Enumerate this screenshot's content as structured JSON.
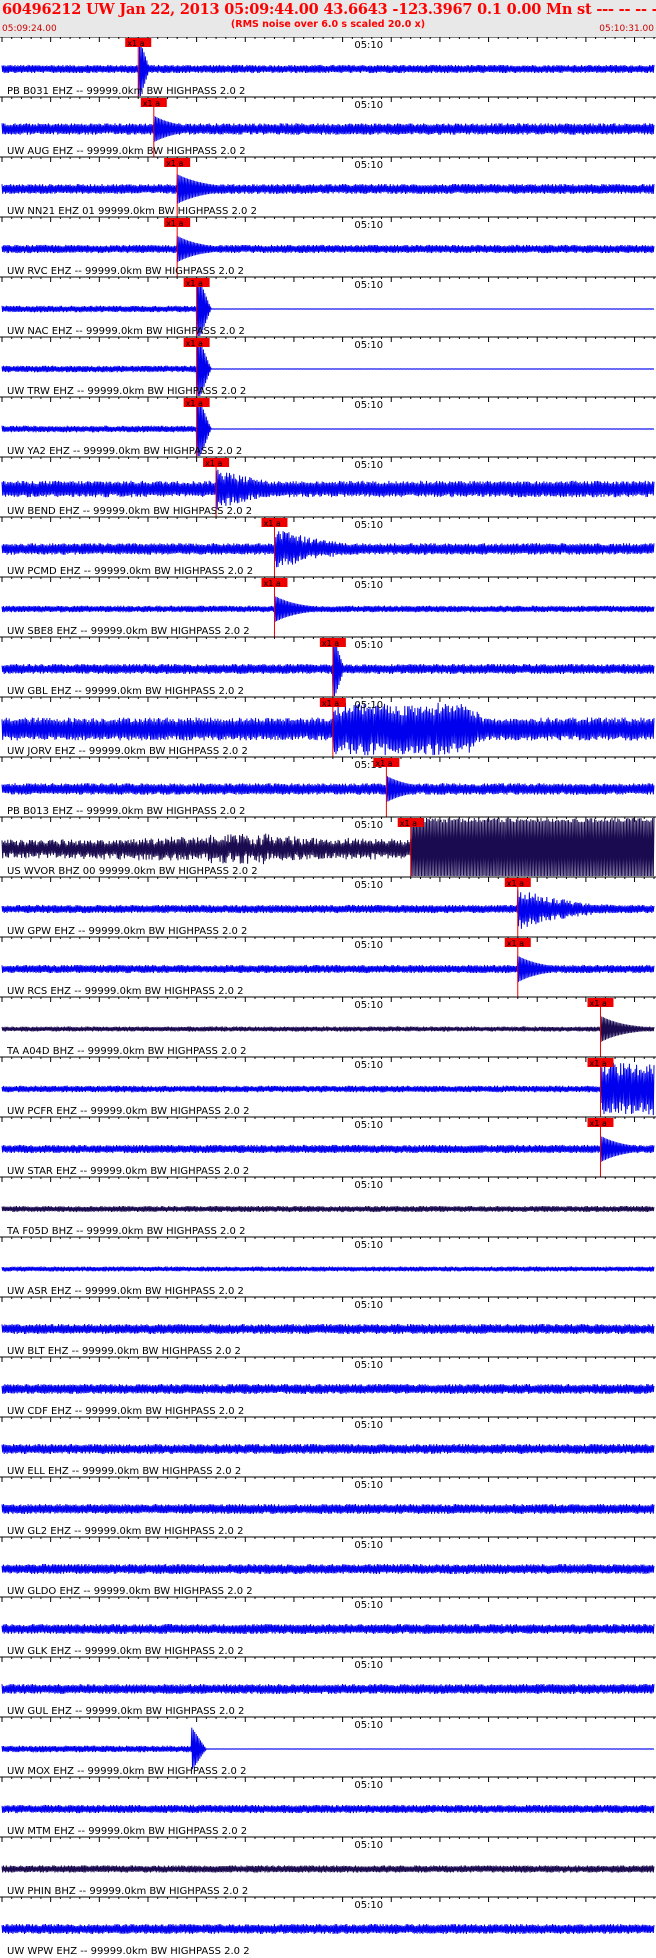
{
  "header": {
    "title": "60496212 UW Jan 22, 2013 05:09:44.00   43.6643 -123.3967  0.1 0.00 Mn st --- -- --   -1",
    "subtitle": "(RMS noise over 6.0 s scaled 20.0 x)",
    "time_start": "05:09:24.00",
    "time_end": "05:10:31.00"
  },
  "colors": {
    "trace_blue": "#0000ee",
    "trace_dark": "#1a0a50",
    "pick_red": "#ee0000",
    "grid": "#000000",
    "header_bg": "#e8e8e8"
  },
  "chart_data": {
    "type": "line",
    "title": "60496212 UW Jan 22, 2013 05:09:44.00   43.6643 -123.3967  0.1 0.00 Mn st --- -- --   -1",
    "subtitle": "(RMS noise over 6.0 s scaled 20.0 x)",
    "x_range": [
      "05:09:24.00",
      "05:10:31.00"
    ],
    "x_tick_label": "05:10",
    "x_tick_time_s": 36,
    "duration_s": 67,
    "pick_label": "x1 a",
    "traces": [
      {
        "label": "PB B031 EHZ -- 99999.0km BW  HIGHPASS  2.0  2",
        "pick_s": 14.0,
        "amp": 0.25,
        "color": "blue",
        "event": "spike"
      },
      {
        "label": "UW AUG EHZ -- 99999.0km BW  HIGHPASS  2.0  2",
        "pick_s": 15.6,
        "amp": 0.35,
        "color": "blue",
        "event": "small"
      },
      {
        "label": "UW NN21 EHZ 01 99999.0km BW  HIGHPASS  2.0  2",
        "pick_s": 18.0,
        "amp": 0.3,
        "color": "blue",
        "event": "bursts"
      },
      {
        "label": "UW RVC EHZ -- 99999.0km BW  HIGHPASS  2.0  2",
        "pick_s": 18.0,
        "amp": 0.25,
        "color": "blue",
        "event": "small"
      },
      {
        "label": "UW NAC EHZ -- 99999.0km BW  HIGHPASS  2.0  2",
        "pick_s": 20.0,
        "amp": 0.2,
        "color": "blue",
        "event": "clip"
      },
      {
        "label": "UW TRW EHZ -- 99999.0km BW  HIGHPASS  2.0  2",
        "pick_s": 20.0,
        "amp": 0.2,
        "color": "blue",
        "event": "clip"
      },
      {
        "label": "UW YA2 EHZ -- 99999.0km BW  HIGHPASS  2.0  2",
        "pick_s": 20.0,
        "amp": 0.2,
        "color": "blue",
        "event": "clip"
      },
      {
        "label": "UW BEND EHZ -- 99999.0km BW  HIGHPASS  2.0  2",
        "pick_s": 22.0,
        "amp": 0.5,
        "color": "blue",
        "event": "coda"
      },
      {
        "label": "UW PCMD EHZ -- 99999.0km BW  HIGHPASS  2.0  2",
        "pick_s": 28.0,
        "amp": 0.35,
        "color": "blue",
        "event": "coda"
      },
      {
        "label": "UW SBE8 EHZ -- 99999.0km BW  HIGHPASS  2.0  2",
        "pick_s": 28.0,
        "amp": 0.2,
        "color": "blue",
        "event": "small"
      },
      {
        "label": "UW GBL EHZ -- 99999.0km BW  HIGHPASS  2.0  2",
        "pick_s": 34.0,
        "amp": 0.3,
        "color": "blue",
        "event": "spike"
      },
      {
        "label": "UW JORV EHZ -- 99999.0km BW  HIGHPASS  2.0  2",
        "pick_s": 34.0,
        "amp": 0.7,
        "color": "blue",
        "event": "big"
      },
      {
        "label": "PB B013 EHZ -- 99999.0km BW  HIGHPASS  2.0  2",
        "pick_s": 39.5,
        "amp": 0.35,
        "color": "blue",
        "event": "small"
      },
      {
        "label": "US WVOR BHZ 00 99999.0km BW  HIGHPASS  2.0  2",
        "pick_s": 42.0,
        "amp": 0.55,
        "color": "dark",
        "event": "block"
      },
      {
        "label": "UW GPW EHZ -- 99999.0km BW  HIGHPASS  2.0  2",
        "pick_s": 53.0,
        "amp": 0.25,
        "color": "blue",
        "event": "coda"
      },
      {
        "label": "UW RCS EHZ -- 99999.0km BW  HIGHPASS  2.0  2",
        "pick_s": 53.0,
        "amp": 0.25,
        "color": "blue",
        "event": "small"
      },
      {
        "label": "TA A04D BHZ -- 99999.0km BW  HIGHPASS  2.0  2",
        "pick_s": 61.5,
        "amp": 0.15,
        "color": "dark",
        "event": "small"
      },
      {
        "label": "UW PCFR EHZ -- 99999.0km BW  HIGHPASS  2.0  2",
        "pick_s": 61.5,
        "amp": 0.2,
        "color": "blue",
        "event": "big"
      },
      {
        "label": "UW STAR EHZ -- 99999.0km BW  HIGHPASS  2.0  2",
        "pick_s": 61.5,
        "amp": 0.25,
        "color": "blue",
        "event": "small"
      },
      {
        "label": "TA F05D BHZ -- 99999.0km BW  HIGHPASS  2.0  2",
        "pick_s": null,
        "amp": 0.18,
        "color": "dark",
        "event": "none"
      },
      {
        "label": "UW ASR EHZ -- 99999.0km BW  HIGHPASS  2.0  2",
        "pick_s": null,
        "amp": 0.15,
        "color": "blue",
        "event": "none"
      },
      {
        "label": "UW BLT EHZ -- 99999.0km BW  HIGHPASS  2.0  2",
        "pick_s": null,
        "amp": 0.3,
        "color": "blue",
        "event": "none"
      },
      {
        "label": "UW CDF EHZ -- 99999.0km BW  HIGHPASS  2.0  2",
        "pick_s": null,
        "amp": 0.3,
        "color": "blue",
        "event": "none"
      },
      {
        "label": "UW ELL EHZ -- 99999.0km BW  HIGHPASS  2.0  2",
        "pick_s": null,
        "amp": 0.3,
        "color": "blue",
        "event": "none"
      },
      {
        "label": "UW GL2 EHZ -- 99999.0km BW  HIGHPASS  2.0  2",
        "pick_s": null,
        "amp": 0.3,
        "color": "blue",
        "event": "none"
      },
      {
        "label": "UW GLDO EHZ -- 99999.0km BW  HIGHPASS  2.0  2",
        "pick_s": null,
        "amp": 0.3,
        "color": "blue",
        "event": "none"
      },
      {
        "label": "UW GLK EHZ -- 99999.0km BW  HIGHPASS  2.0  2",
        "pick_s": null,
        "amp": 0.3,
        "color": "blue",
        "event": "none"
      },
      {
        "label": "UW GUL EHZ -- 99999.0km BW  HIGHPASS  2.0  2",
        "pick_s": null,
        "amp": 0.3,
        "color": "blue",
        "event": "none"
      },
      {
        "label": "UW MOX EHZ -- 99999.0km BW  HIGHPASS  2.0  2",
        "pick_s": null,
        "amp": 0.2,
        "color": "blue",
        "event": "clip_mid"
      },
      {
        "label": "UW MTM EHZ -- 99999.0km BW  HIGHPASS  2.0  2",
        "pick_s": null,
        "amp": 0.25,
        "color": "blue",
        "event": "none"
      },
      {
        "label": "UW PHIN BHZ -- 99999.0km BW  HIGHPASS  2.0  2",
        "pick_s": null,
        "amp": 0.22,
        "color": "dark",
        "event": "none"
      },
      {
        "label": "UW WPW EHZ -- 99999.0km BW  HIGHPASS  2.0  2",
        "pick_s": null,
        "amp": 0.3,
        "color": "blue",
        "event": "none"
      }
    ]
  }
}
